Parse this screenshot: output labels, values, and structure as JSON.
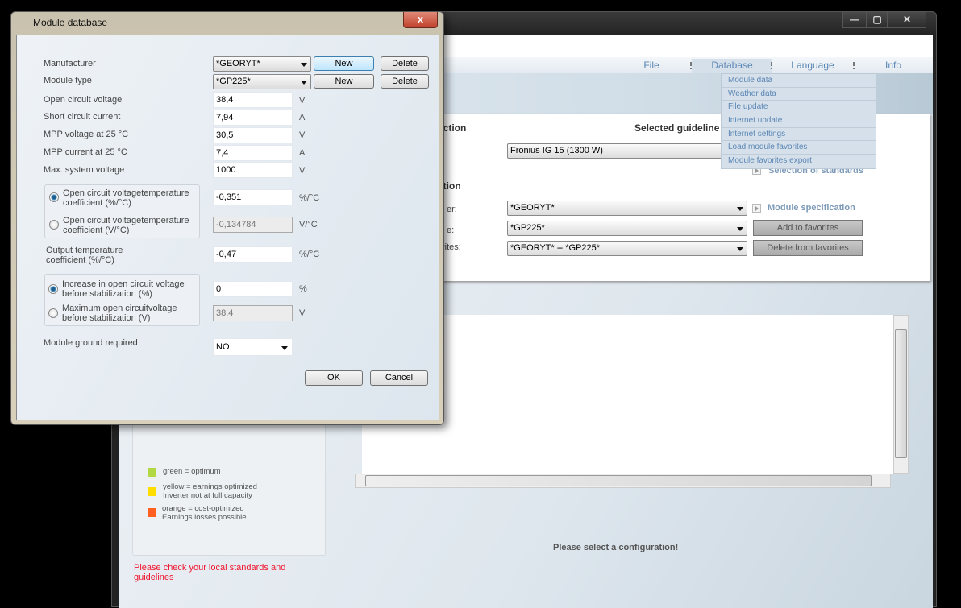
{
  "main_window": {
    "controls": {
      "minimize": "—",
      "maximize": "▢",
      "close": "✕"
    },
    "menu": [
      "File",
      "Database",
      "Language",
      "Info"
    ],
    "database_menu": [
      "Module data",
      "Weather data",
      "File update",
      "Internet update",
      "Internet settings",
      "Load module favorites",
      "Module favorites export"
    ],
    "inverter_section_title": "election",
    "selected_guidelines_label": "Selected guideline",
    "inverter_value": "Fronius IG 15 (1300 W)",
    "selection_of_standards": "Selection of standards",
    "module_section_title": "lection",
    "module_rows": [
      {
        "label": "er:",
        "value": "*GEORYT*"
      },
      {
        "label": "e:",
        "value": "*GP225*"
      },
      {
        "label": "rites:",
        "value": "*GEORYT* -- *GP225*"
      }
    ],
    "module_specification": "Module specification",
    "add_to_favorites": "Add to favorites",
    "delete_from_favorites": "Delete from favorites",
    "legend": [
      {
        "color": "#b2d844",
        "line1": "green = optimum",
        "line2": ""
      },
      {
        "color": "#ffdd00",
        "line1": "yellow =  earnings optimized",
        "line2": "Inverter not at full capacity"
      },
      {
        "color": "#ff6020",
        "line1": "orange = cost-optimized",
        "line2": "Earnings losses possible"
      }
    ],
    "warning": "Please check your local standards and guidelines",
    "status": "Please select a configuration!"
  },
  "dialog": {
    "title": "Module database",
    "close": "x",
    "manufacturer": {
      "label": "Manufacturer",
      "value": "*GEORYT*",
      "new": "New",
      "delete": "Delete"
    },
    "module_type": {
      "label": "Module type",
      "value": "*GP225*",
      "new": "New",
      "delete": "Delete"
    },
    "fields": [
      {
        "label": "Open circuit voltage",
        "value": "38,4",
        "unit": "V"
      },
      {
        "label": "Short circuit current",
        "value": "7,94",
        "unit": "A"
      },
      {
        "label": "MPP voltage at 25 °C",
        "value": "30,5",
        "unit": "V"
      },
      {
        "label": "MPP current at 25 °C",
        "value": "7,4",
        "unit": "A"
      },
      {
        "label": "Max. system voltage",
        "value": "1000",
        "unit": "V"
      }
    ],
    "voc_coeff": [
      {
        "label": "Open circuit voltagetemperature coefficient (%/°C)",
        "value": "-0,351",
        "unit": "%/°C",
        "selected": true
      },
      {
        "label": "Open circuit voltagetemperature coefficient (V/°C)",
        "value": "-0,134784",
        "unit": "V/°C",
        "selected": false
      }
    ],
    "output_coeff": {
      "label": "Output temperature coefficient (%/°C)",
      "value": "-0,47",
      "unit": "%/°C"
    },
    "stabilization": [
      {
        "label": "Increase in open circuit voltage before stabilization (%)",
        "value": "0",
        "unit": "%",
        "selected": true
      },
      {
        "label": "Maximum open circuitvoltage before stabilization (V)",
        "value": "38,4",
        "unit": "V",
        "selected": false
      }
    ],
    "ground": {
      "label": "Module ground required",
      "value": "NO"
    },
    "ok": "OK",
    "cancel": "Cancel"
  }
}
